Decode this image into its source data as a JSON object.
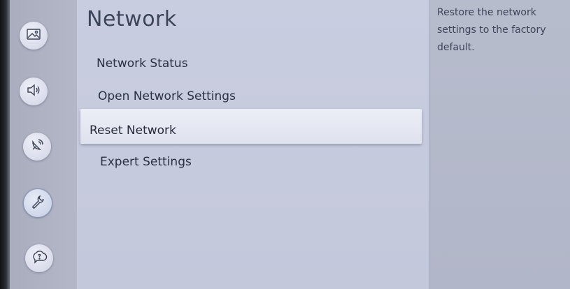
{
  "title": "Network",
  "menu": {
    "items": [
      {
        "label": "Network Status"
      },
      {
        "label": "Open Network Settings"
      },
      {
        "label": "Reset Network",
        "selected": true
      },
      {
        "label": "Expert Settings"
      }
    ]
  },
  "description": "Restore the network settings to the factory default.",
  "sidebar": {
    "icons": [
      "picture-icon",
      "sound-icon",
      "broadcasting-icon",
      "general-wrench-icon",
      "support-icon"
    ],
    "active": "general-wrench-icon"
  },
  "colors": {
    "panel": "#c6cadd",
    "rail": "#aeb2c2",
    "selected_bg": "#e6e8f2",
    "text": "#2b3142"
  }
}
